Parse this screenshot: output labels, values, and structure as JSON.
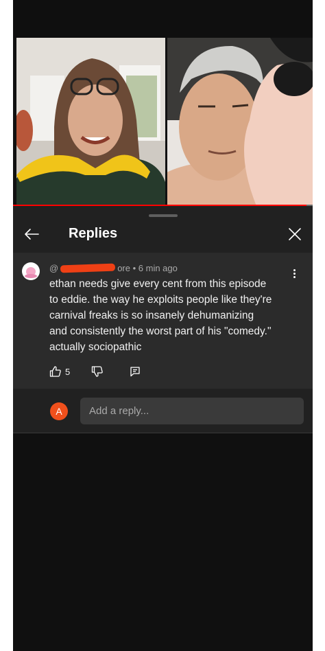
{
  "video": {
    "progress": 0.98
  },
  "header": {
    "title": "Replies",
    "back_icon": "arrow-left-icon",
    "close_icon": "close-icon"
  },
  "comment": {
    "handle_prefix": "@",
    "handle_suffix": "ore",
    "time": " • 6 min ago",
    "body": "ethan needs give every cent from this episode\nto eddie. the way he exploits people like they're\ncarnival freaks is so insanely dehumanizing\nand consistently the worst part of his \"comedy.\"\nactually sociopathic",
    "likes": "5",
    "icons": [
      "thumbs-up-icon",
      "thumbs-down-icon",
      "reply-icon",
      "more-vert-icon"
    ]
  },
  "reply": {
    "avatar_letter": "A",
    "placeholder": "Add a reply..."
  },
  "colors": {
    "accent": "#ff0000",
    "avatar": "#f0501c",
    "redaction": "#ef4015"
  }
}
